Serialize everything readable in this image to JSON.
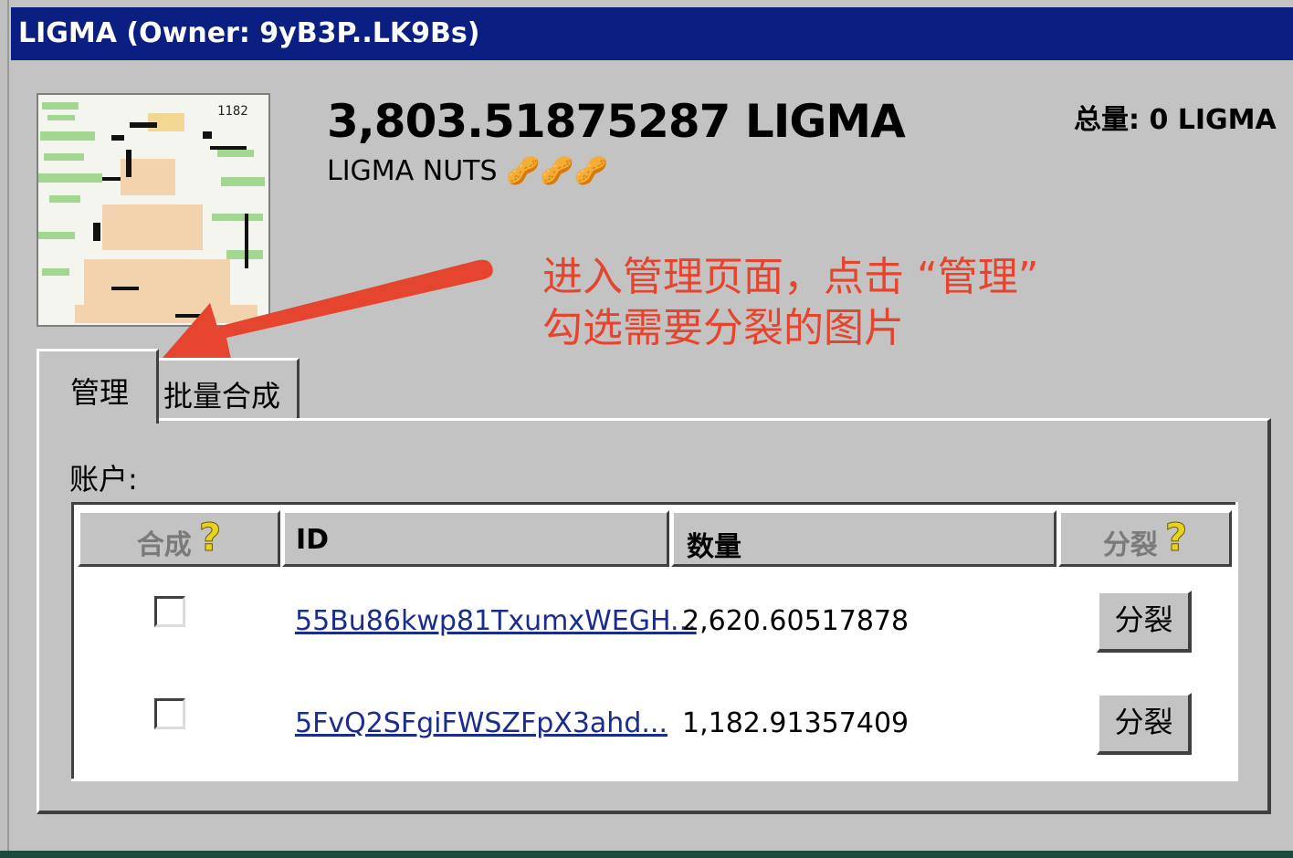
{
  "window": {
    "title": "LIGMA (Owner: 9yB3P..LK9Bs)"
  },
  "token": {
    "balance": "3,803.51875287 LIGMA",
    "name": "LIGMA NUTS 🥜🥜🥜",
    "total": "总量: 0 LIGMA"
  },
  "annotation": {
    "text": "进入管理页面，点击 “管理”\n勾选需要分裂的图片",
    "color": "#e5452f"
  },
  "tabs": [
    {
      "label": "管理",
      "active": true
    },
    {
      "label": "批量合成",
      "active": false
    }
  ],
  "panel": {
    "account_label": "账户:"
  },
  "table": {
    "headers": {
      "merge": "合成",
      "id": "ID",
      "qty": "数量",
      "split": "分裂",
      "help_glyph": "?"
    },
    "rows": [
      {
        "id": "55Bu86kwp81TxumxWEGH...",
        "qty": "2,620.60517878",
        "button": "分裂",
        "checked": false
      },
      {
        "id": "5FvQ2SFgiFWSZFpX3ahd...",
        "qty": "1,182.91357409",
        "button": "分裂",
        "checked": false
      }
    ]
  },
  "colors": {
    "titlebar": "#0b1f82",
    "window_bg": "#c3c3c3",
    "link": "#1a2d8f"
  },
  "icons": {
    "help": "question-mark-icon",
    "arrow": "annotation-arrow-icon",
    "thumbnail": "nft-thumbnail"
  }
}
